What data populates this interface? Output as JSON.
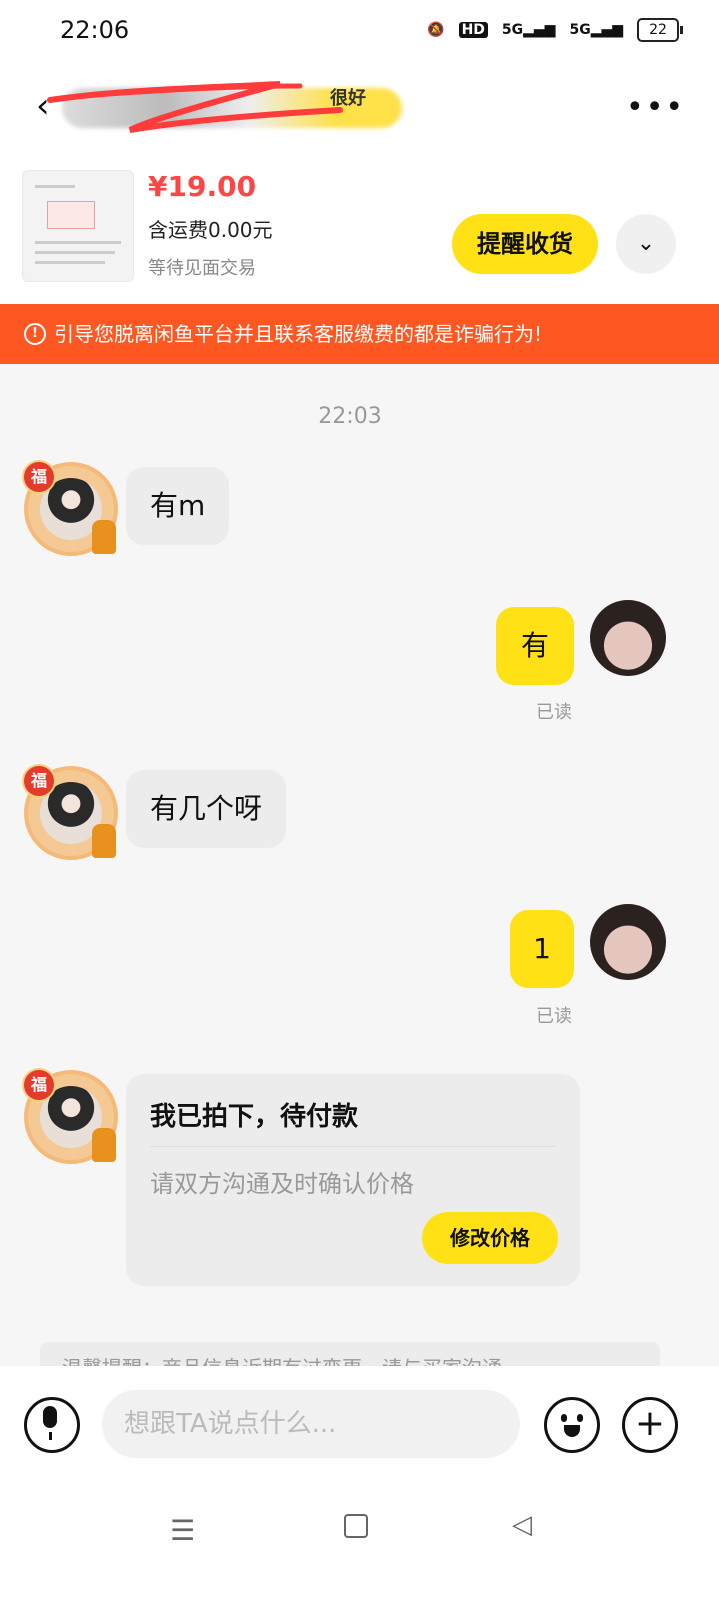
{
  "status_bar": {
    "time": "22:06",
    "hd": "HD",
    "signal_1": "5G",
    "signal_2": "5G",
    "battery": "22"
  },
  "header": {
    "seller_name_fragment": "很好",
    "more_icon": "more-dots-icon",
    "back_icon": "back-arrow-icon"
  },
  "product": {
    "price": "¥19.00",
    "shipping": "含运费0.00元",
    "status": "等待见面交易",
    "remind_button": "提醒收货",
    "expand_icon": "chevron-down-icon"
  },
  "warning": {
    "text": "引导您脱离闲鱼平台并且联系客服缴费的都是诈骗行为!",
    "icon": "!"
  },
  "chat": {
    "timestamp": "22:03",
    "avatar_badge": "福",
    "messages": [
      {
        "side": "left",
        "text": "有m"
      },
      {
        "side": "right",
        "text": "有",
        "status": "已读"
      },
      {
        "side": "left",
        "text": "有几个呀"
      },
      {
        "side": "right",
        "text": "1",
        "status": "已读"
      }
    ],
    "card": {
      "title": "我已拍下，待付款",
      "subtitle": "请双方沟通及时确认价格",
      "button": "修改价格"
    },
    "notice": "温馨提醒：商品信息近期有过变更，请与买家沟通"
  },
  "input_bar": {
    "placeholder": "想跟TA说点什么...",
    "plus": "+"
  },
  "colors": {
    "accent_yellow": "#ffe116",
    "warning_orange": "#ff5722",
    "price_red": "#ff4646"
  }
}
